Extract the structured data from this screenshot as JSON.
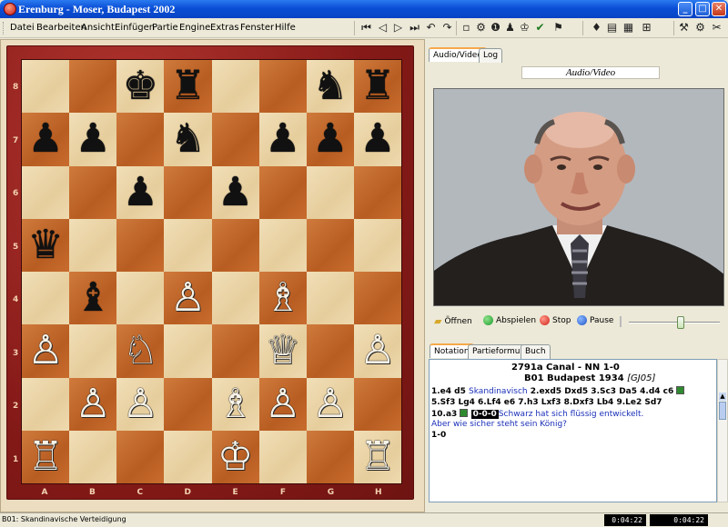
{
  "window": {
    "title": "Erenburg - Moser, Budapest 2002",
    "min": "_",
    "max": "□",
    "close": "✕"
  },
  "menu": [
    "Datei",
    "Bearbeiten",
    "Ansicht",
    "Einfügen",
    "Partie",
    "Engine",
    "Extras",
    "Fenster",
    "Hilfe"
  ],
  "toolbar_icons": [
    "first-move-icon",
    "previous-move-icon",
    "next-move-icon",
    "last-move-icon",
    "undo-icon",
    "redo-icon",
    "new-icon",
    "engine-icon",
    "info-icon",
    "piece-icon",
    "king-icon",
    "checkmark-icon",
    "flag-icon",
    "bulb-icon",
    "book-icon",
    "table-icon",
    "grid-icon",
    "tools-icon",
    "settings-icon"
  ],
  "board": {
    "files": [
      "A",
      "B",
      "C",
      "D",
      "E",
      "F",
      "G",
      "H"
    ],
    "ranks": [
      "8",
      "7",
      "6",
      "5",
      "4",
      "3",
      "2",
      "1"
    ],
    "position": [
      [
        "",
        "",
        "♚",
        "♜",
        "",
        "",
        "♞",
        "♜"
      ],
      [
        "♟",
        "♟",
        "",
        "♞",
        "",
        "♟",
        "♟",
        "♟"
      ],
      [
        "",
        "",
        "♟",
        "",
        "♟",
        "",
        "",
        ""
      ],
      [
        "♛",
        "",
        "",
        "",
        "",
        "",
        "",
        ""
      ],
      [
        "",
        "♝",
        "",
        "♙",
        "",
        "♗",
        "",
        ""
      ],
      [
        "♙",
        "",
        "♘",
        "",
        "",
        "♕",
        "",
        "♙"
      ],
      [
        "",
        "♙",
        "♙",
        "",
        "♗",
        "♙",
        "♙",
        ""
      ],
      [
        "♖",
        "",
        "",
        "",
        "♔",
        "",
        "",
        "♖"
      ]
    ]
  },
  "right_tabs": [
    "Audio/Video",
    "Log"
  ],
  "av_header": "Audio/Video",
  "controls": {
    "open": "Öffnen",
    "play": "Abspielen",
    "stop": "Stop",
    "pause": "Pause",
    "slider_fraction": 0.53
  },
  "notation_tabs": [
    "Notation",
    "Partieformular",
    "Buch"
  ],
  "game": {
    "header1": "2791a Canal - NN  1-0",
    "header2_main": "B01 Budapest 1934",
    "header2_ref": "[GJ05]",
    "line1_a": "1.e4  d5",
    "line1_comment": "Skandinavisch",
    "line1_b": "2.exd5  Dxd5  3.Sc3  Da5  4.d4  c6",
    "line2": "5.Sf3  Lg4  6.Lf4  e6  7.h3  Lxf3  8.Dxf3  Lb4  9.Le2  Sd7",
    "line3_move": "10.a3",
    "line3_castle": "0-0-0",
    "line3_comment": "Schwarz hat sich flüssig entwickelt.",
    "line4_comment": "Aber wie sicher steht sein König?",
    "result": "1-0"
  },
  "status": {
    "text": "B01: Skandinavische Verteidigung",
    "time1": "0:04:22",
    "time2": "0:04:22"
  }
}
